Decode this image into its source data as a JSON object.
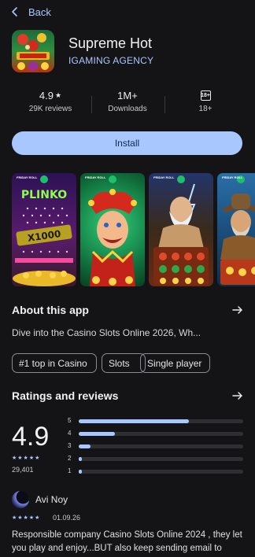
{
  "nav": {
    "back_label": "Back"
  },
  "app": {
    "title": "Supreme Hot",
    "developer": "IGAMING AGENCY"
  },
  "stats": {
    "rating": "4.9",
    "reviews": "29K reviews",
    "downloads": "1M+",
    "downloads_label": "Downloads",
    "age_badge": "18+",
    "age_label": "18+"
  },
  "install": {
    "label": "Install"
  },
  "screenshots": [
    {
      "brand": "FRIDAY ROLL",
      "name": "plinko",
      "caption": "PLINKO",
      "badge": "X1000"
    },
    {
      "brand": "FRIDAY ROLL",
      "name": "jester"
    },
    {
      "brand": "FRIDAY ROLL",
      "name": "zeus"
    },
    {
      "brand": "FRIDAY ROLL",
      "name": "cowboy"
    }
  ],
  "about": {
    "title": "About this app",
    "description": "Dive into the Casino Slots Online 2026, Wh..."
  },
  "tags": [
    "#1 top in Casino",
    "Slots",
    "Single player"
  ],
  "ratings": {
    "title": "Ratings and reviews",
    "score": "4.9",
    "stars": "★★★★★",
    "count": "29,401",
    "bars": [
      {
        "label": "5",
        "fraction": 0.67
      },
      {
        "label": "4",
        "fraction": 0.22
      },
      {
        "label": "3",
        "fraction": 0.07
      },
      {
        "label": "2",
        "fraction": 0.02
      },
      {
        "label": "1",
        "fraction": 0.02
      }
    ]
  },
  "review": {
    "name": "Avi Noy",
    "stars": "★★★★★",
    "date": "01.09.26",
    "text": "Responsible company Casino Slots Online 2024 , they let you play and enjoy...BUT also keep sending email to"
  },
  "colors": {
    "accent": "#a9c7ff",
    "background": "#141416"
  }
}
